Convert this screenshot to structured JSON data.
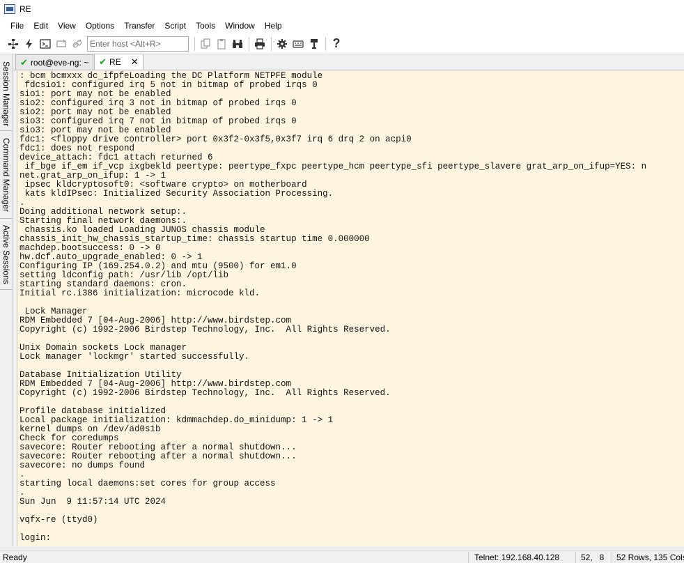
{
  "window": {
    "title": "RE"
  },
  "menu": [
    "File",
    "Edit",
    "View",
    "Options",
    "Transfer",
    "Script",
    "Tools",
    "Window",
    "Help"
  ],
  "toolbar": {
    "host_placeholder": "Enter host <Alt+R>"
  },
  "sidebar": {
    "tabs": [
      "Session Manager",
      "Command Manager",
      "Active Sessions"
    ]
  },
  "tabs": [
    {
      "label": "root@eve-ng: ~"
    },
    {
      "label": "RE"
    }
  ],
  "terminal": {
    "lines": [
      ": bcm bcmxxx dc_ifpfeLoading the DC Platform NETPFE module",
      " fdcsio1: configured irq 5 not in bitmap of probed irqs 0",
      "sio1: port may not be enabled",
      "sio2: configured irq 3 not in bitmap of probed irqs 0",
      "sio2: port may not be enabled",
      "sio3: configured irq 7 not in bitmap of probed irqs 0",
      "sio3: port may not be enabled",
      "fdc1: <floppy drive controller> port 0x3f2-0x3f5,0x3f7 irq 6 drq 2 on acpi0",
      "fdc1: does not respond",
      "device_attach: fdc1 attach returned 6",
      " if_bge if_em if_vcp ixgbekld peertype: peertype_fxpc peertype_hcm peertype_sfi peertype_slavere grat_arp_on_ifup=YES: n",
      "net.grat_arp_on_ifup: 1 -> 1",
      " ipsec kldcryptosoft0: <software crypto> on motherboard",
      " kats kldIPsec: Initialized Security Association Processing.",
      ".",
      "Doing additional network setup:.",
      "Starting final network daemons:.",
      " chassis.ko loaded Loading JUNOS chassis module",
      "chassis_init_hw_chassis_startup_time: chassis startup time 0.000000",
      "machdep.bootsuccess: 0 -> 0",
      "hw.dcf.auto_upgrade_enabled: 0 -> 1",
      "Configuring IP (169.254.0.2) and mtu (9500) for em1.0",
      "setting ldconfig path: /usr/lib /opt/lib",
      "starting standard daemons: cron.",
      "Initial rc.i386 initialization: microcode kld.",
      "",
      " Lock Manager",
      "RDM Embedded 7 [04-Aug-2006] http://www.birdstep.com",
      "Copyright (c) 1992-2006 Birdstep Technology, Inc.  All Rights Reserved.",
      "",
      "Unix Domain sockets Lock manager",
      "Lock manager 'lockmgr' started successfully.",
      "",
      "Database Initialization Utility",
      "RDM Embedded 7 [04-Aug-2006] http://www.birdstep.com",
      "Copyright (c) 1992-2006 Birdstep Technology, Inc.  All Rights Reserved.",
      "",
      "Profile database initialized",
      "Local package initialization: kdmmachdep.do_minidump: 1 -> 1",
      "kernel dumps on /dev/ad0s1b",
      "Check for coredumps",
      "savecore: Router rebooting after a normal shutdown...",
      "savecore: Router rebooting after a normal shutdown...",
      "savecore: no dumps found",
      ".",
      "starting local daemons:set cores for group access",
      ".",
      "Sun Jun  9 11:57:14 UTC 2024",
      "",
      "vqfx-re (ttyd0)",
      "",
      "login:"
    ]
  },
  "status": {
    "state": "Ready",
    "connection": "Telnet: 192.168.40.128",
    "cursor": "52,   8",
    "size": "52 Rows, 135 Cols"
  }
}
